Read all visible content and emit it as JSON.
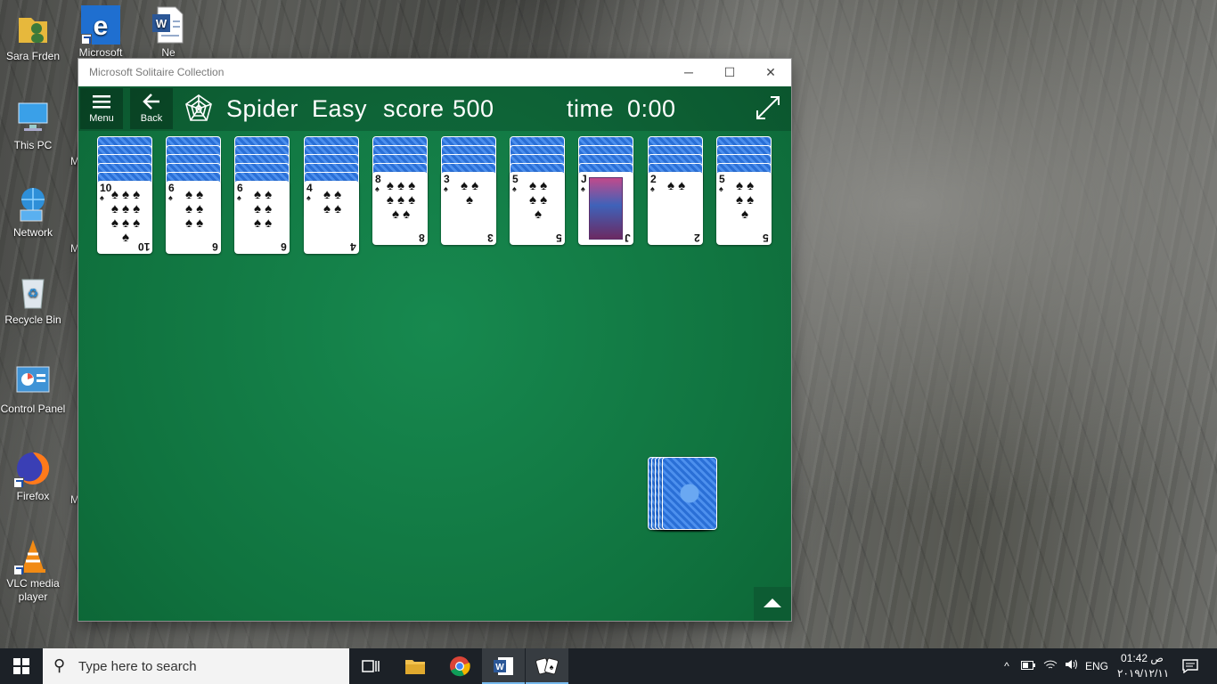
{
  "desktop": {
    "icons": [
      {
        "label": "Sara Frden",
        "icon": "user-folder-icon"
      },
      {
        "label": "This PC",
        "icon": "computer-icon"
      },
      {
        "label": "Network",
        "icon": "network-icon"
      },
      {
        "label": "Recycle Bin",
        "icon": "recycle-bin-icon"
      },
      {
        "label": "Control Panel",
        "icon": "control-panel-icon"
      },
      {
        "label": "Firefox",
        "icon": "firefox-icon"
      },
      {
        "label": "VLC media player",
        "icon": "vlc-icon"
      }
    ],
    "second_column": [
      {
        "label": "Microsoft",
        "icon": "edge-icon"
      },
      {
        "label": "Ne",
        "icon": "word-doc-icon"
      }
    ],
    "partial_letters": [
      "M",
      "M",
      "M"
    ]
  },
  "window": {
    "title": "Microsoft Solitaire Collection",
    "controls": {
      "minimize": "─",
      "maximize": "☐",
      "close": "✕"
    }
  },
  "game": {
    "menu_label": "Menu",
    "back_label": "Back",
    "game_name": "Spider",
    "difficulty": "Easy",
    "score_label": "score",
    "score_value": "500",
    "time_label": "time",
    "time_value": "0:00",
    "suit": "♠",
    "tableau": [
      {
        "face_down": 5,
        "rank": "10"
      },
      {
        "face_down": 5,
        "rank": "6"
      },
      {
        "face_down": 5,
        "rank": "6"
      },
      {
        "face_down": 5,
        "rank": "4"
      },
      {
        "face_down": 4,
        "rank": "8"
      },
      {
        "face_down": 4,
        "rank": "3"
      },
      {
        "face_down": 4,
        "rank": "5"
      },
      {
        "face_down": 4,
        "rank": "J"
      },
      {
        "face_down": 4,
        "rank": "2"
      },
      {
        "face_down": 4,
        "rank": "5"
      }
    ],
    "stock_piles": 5
  },
  "taskbar": {
    "search_placeholder": "Type here to search",
    "apps": [
      "task-view-icon",
      "file-explorer-icon",
      "chrome-icon",
      "word-icon",
      "solitaire-icon"
    ],
    "language": "ENG",
    "time": "01:42",
    "ampm": "ص",
    "date": "٢٠١٩/١٢/١١"
  },
  "colors": {
    "felt": "#10733f",
    "card_back": "#2a6fd6",
    "taskbar": "#1c2127"
  }
}
